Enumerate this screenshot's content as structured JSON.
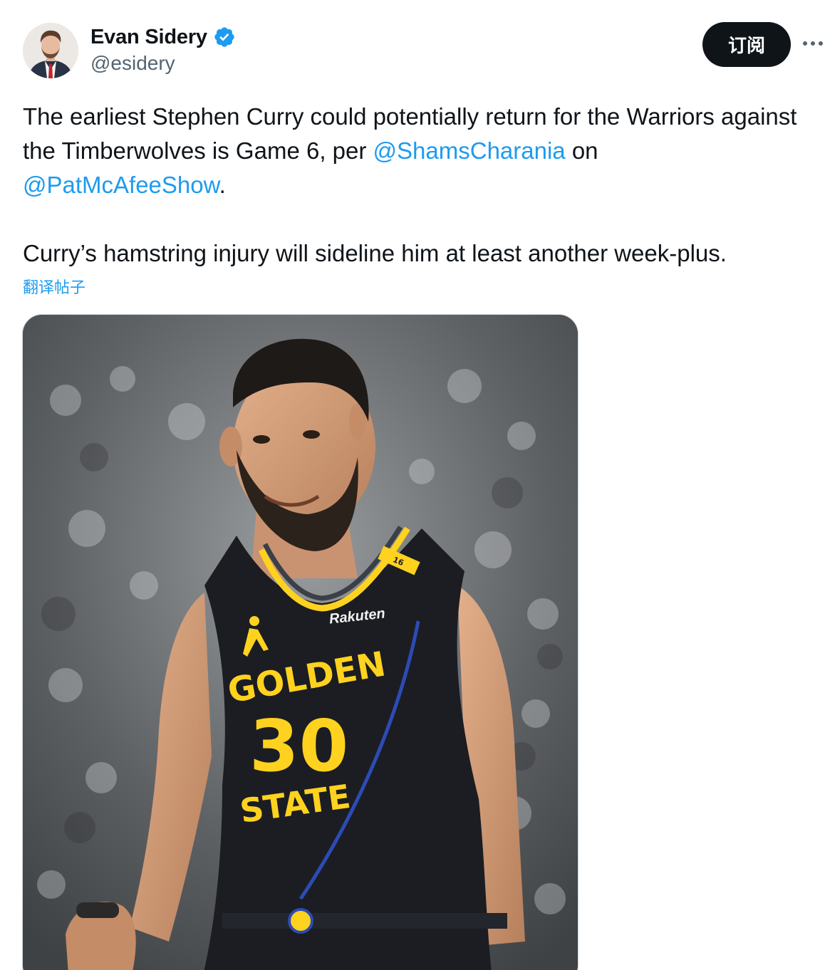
{
  "author": {
    "name": "Evan Sidery",
    "handle": "@esidery",
    "verified": true,
    "avatar_icon": "profile-photo"
  },
  "actions": {
    "subscribe_label": "订阅",
    "more_icon": "more-horizontal-icon"
  },
  "tweet": {
    "line1_before": "The earliest Stephen Curry could potentially return for the Warriors against the Timberwolves is Game 6, per ",
    "mention1": "@ShamsCharania",
    "line1_middle": " on ",
    "mention2": "@PatMcAfeeShow",
    "line1_end": ".",
    "paragraph2": "Curry’s hamstring injury will sideline him at least another week-plus.",
    "translate_label": "翻译帖子"
  },
  "media": {
    "jersey_logo_text": "Rakuten",
    "jersey_team_word1": "GOLDEN",
    "jersey_number": "30",
    "jersey_team_word2": "STATE",
    "jersey_badge": "16"
  },
  "colors": {
    "link": "#1d9bf0",
    "text": "#0f1419",
    "secondary": "#536471",
    "button_bg": "#0f1419",
    "verified": "#1d9bf0",
    "jersey_yellow": "#ffd21f",
    "jersey_navy": "#1b1d22"
  }
}
